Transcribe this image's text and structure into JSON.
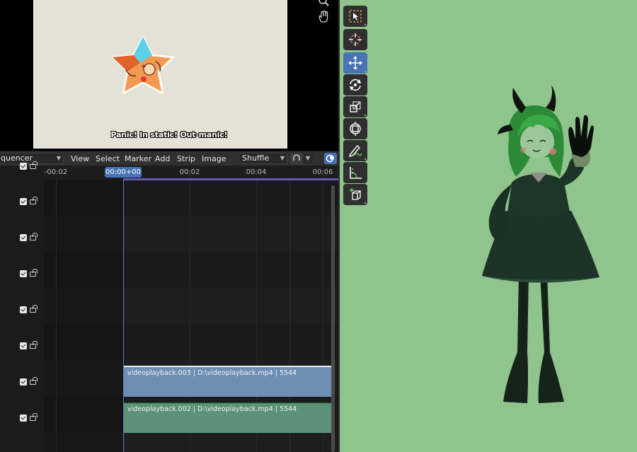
{
  "preview": {
    "subtitle": "Panic! In static! Out-manic!",
    "icons": [
      "zoom-icon",
      "hand-pan-icon"
    ]
  },
  "sequencer_header": {
    "editor_type": "quencer",
    "menus": [
      "View",
      "Select",
      "Marker",
      "Add",
      "Strip",
      "Image"
    ],
    "overlap_mode": "Shuffle"
  },
  "timeline": {
    "current_frame": "00:00+00",
    "ruler_labels": [
      "-00:02",
      "00:02",
      "00:04",
      "00:06"
    ],
    "channel_count": 8,
    "strips": [
      {
        "name": "videoplayback.003 | D:\\videoplayback.mp4 | 5544",
        "color": "#6f8eb4",
        "selected": true
      },
      {
        "name": "videoplayback.002 | D:\\videoplayback.mp4 | 5544",
        "color": "#5c9277",
        "selected": false
      }
    ]
  },
  "viewport": {
    "background": "#8fc48c",
    "tools": [
      "select-box-icon",
      "cursor-icon",
      "move-icon",
      "rotate-icon",
      "scale-icon",
      "transform-icon",
      "annotate-icon",
      "measure-icon",
      "add-cube-icon"
    ],
    "active_tool": "move-icon"
  }
}
